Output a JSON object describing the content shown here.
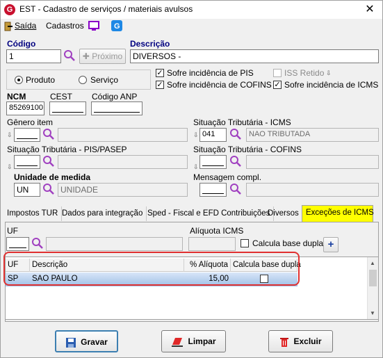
{
  "window": {
    "title": "EST - Cadastro de serviços / materiais avulsos",
    "close_glyph": "✕"
  },
  "menu": {
    "saida": "Saída",
    "cadastros": "Cadastros"
  },
  "codigo": {
    "label": "Código",
    "value": "1"
  },
  "proximo_button": "Próximo",
  "descricao": {
    "label": "Descrição",
    "value": "DIVERSOS -"
  },
  "tipo": {
    "produto": "Produto",
    "servico": "Serviço",
    "selected": "Produto"
  },
  "checks": {
    "pis": {
      "label": "Sofre incidência de PIS",
      "checked": true
    },
    "cofins": {
      "label": "Sofre incidência de COFINS",
      "checked": true
    },
    "iss": {
      "label": "ISS Retido",
      "checked": false,
      "disabled": true
    },
    "icms": {
      "label": "Sofre incidência de ICMS",
      "checked": true
    }
  },
  "ncm": {
    "label": "NCM",
    "value": "85269100"
  },
  "cest": {
    "label": "CEST",
    "value": ""
  },
  "codigo_anp": {
    "label": "Código ANP",
    "value": ""
  },
  "genero_item": {
    "label": "Gênero item",
    "value": "",
    "desc": ""
  },
  "sit_icms": {
    "label": "Situação Tributária - ICMS",
    "value": "041",
    "desc": "NAO TRIBUTADA"
  },
  "sit_pis": {
    "label": "Situação Tributária - PIS/PASEP",
    "value": "",
    "desc": ""
  },
  "sit_cofins": {
    "label": "Situação Tributária - COFINS",
    "value": "",
    "desc": ""
  },
  "unidade": {
    "label": "Unidade de medida",
    "value": "UN",
    "desc": "UNIDADE"
  },
  "mensagem": {
    "label": "Mensagem compl.",
    "value": "",
    "desc": ""
  },
  "tabs": [
    {
      "label": "Impostos TUR"
    },
    {
      "label": "Dados para integração"
    },
    {
      "label": "Sped - Fiscal e EFD Contribuições"
    },
    {
      "label": "Diversos"
    },
    {
      "label": "Exceções de ICMS"
    }
  ],
  "active_tab": "Exceções de ICMS",
  "excecoes": {
    "uf_label": "UF",
    "uf_value": "",
    "aliquota_label": "Alíquota ICMS",
    "aliquota_value": "",
    "calcula_label": "Calcula base dupla",
    "add_glyph": "+"
  },
  "grid": {
    "columns": [
      "UF",
      "Descrição",
      "% Alíquota",
      "Calcula base dupla"
    ],
    "rows": [
      {
        "uf": "SP",
        "descricao": "SAO PAULO",
        "aliquota": "15,00",
        "calcula": false
      }
    ]
  },
  "buttons": {
    "gravar": "Gravar",
    "limpar": "Limpar",
    "excluir": "Excluir"
  },
  "colors": {
    "label_blue": "#000080",
    "active_tab": "#ffff00",
    "selection": "#9fbfe6",
    "highlight": "#e03030",
    "brand": "#c8102e"
  }
}
